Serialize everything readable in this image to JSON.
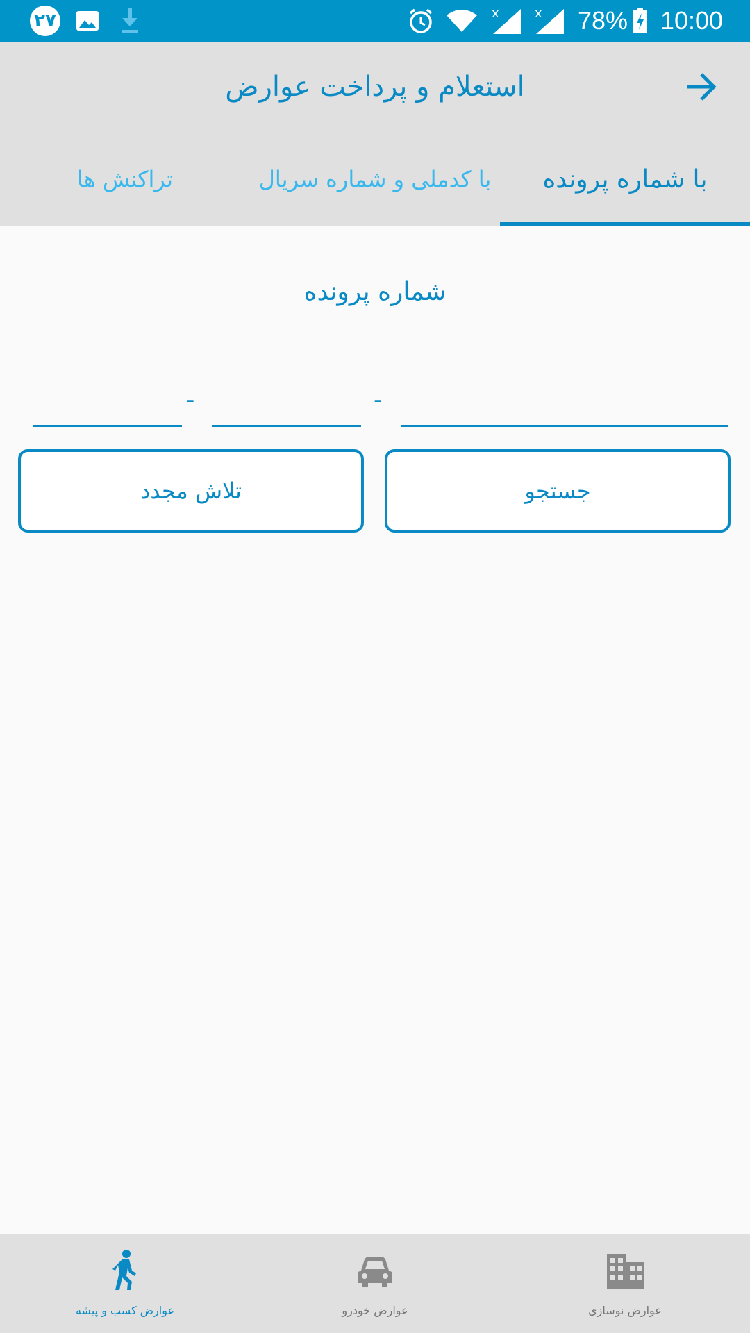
{
  "status_bar": {
    "notification_count": "۲۷",
    "battery": "78%",
    "time": "10:00"
  },
  "app_bar": {
    "title": "استعلام و پرداخت عوارض",
    "back_icon": "arrow-right-icon"
  },
  "tabs": [
    {
      "label": "با شماره پرونده",
      "active": true
    },
    {
      "label": "با کدملی و شماره سریال",
      "active": false
    },
    {
      "label": "تراکنش ها",
      "active": false
    }
  ],
  "form": {
    "title": "شماره پرونده",
    "separator": "-",
    "fields": [
      {
        "value": "",
        "placeholder": ""
      },
      {
        "value": "",
        "placeholder": ""
      },
      {
        "value": "",
        "placeholder": ""
      }
    ],
    "search_label": "جستجو",
    "retry_label": "تلاش مجدد"
  },
  "bottom_nav": [
    {
      "label": "عوارض نوسازی",
      "icon": "building-icon",
      "active": false
    },
    {
      "label": "عوارض خودرو",
      "icon": "car-icon",
      "active": false
    },
    {
      "label": "عوارض کسب و پیشه",
      "icon": "walking-person-icon",
      "active": true
    }
  ],
  "colors": {
    "primary": "#0094c9",
    "accent": "#0a8ac4",
    "tab_inactive": "#39b8ee",
    "bar_background": "#e0e0e0"
  }
}
